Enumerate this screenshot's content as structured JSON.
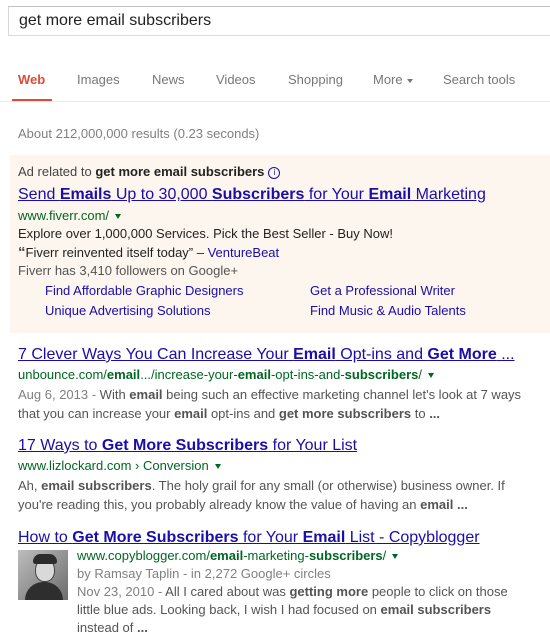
{
  "search": {
    "query": "get more email subscribers"
  },
  "tabs": {
    "web": "Web",
    "images": "Images",
    "news": "News",
    "videos": "Videos",
    "shopping": "Shopping",
    "more": "More",
    "tools": "Search tools"
  },
  "stats": "About 212,000,000 results (0.23 seconds)",
  "ad": {
    "header_prefix": "Ad related to ",
    "header_query": "get more email subscribers",
    "info_glyph": "i",
    "title": {
      "p1": "Send ",
      "b1": "Emails",
      "p2": " Up to 30,000 ",
      "b2": "Subscribers",
      "p3": " for Your ",
      "b3": "Email",
      "p4": " Marketing"
    },
    "url": "www.fiverr.com/",
    "line1": "Explore over 1,000,000 Services. Pick the Best Seller - Buy Now!",
    "quote_open": "“",
    "quote_text": "Fiverr reinvented itself today",
    "quote_close": "” – ",
    "quote_source": "VentureBeat",
    "followers": "Fiverr has 3,410 followers on Google+",
    "sitelinks": [
      "Find Affordable Graphic Designers",
      "Get a Professional Writer",
      "Unique Advertising Solutions",
      "Find Music & Audio Talents"
    ]
  },
  "results": [
    {
      "title": {
        "p1": "7 Clever Ways You Can Increase Your ",
        "b1": "Email",
        "p2": " Opt-ins and ",
        "b2": "Get More",
        "p3": " ..."
      },
      "url": {
        "p1": "unbounce.com/",
        "b1": "email",
        "p2": ".../increase-your-",
        "b2": "email",
        "p3": "-opt-ins-and-",
        "b3": "subscribers",
        "p4": "/"
      },
      "date": "Aug 6, 2013 - ",
      "snippet1": {
        "p1": "With ",
        "b1": "email",
        "p2": " being such an effective marketing channel let's look at 7 ways"
      },
      "snippet2": {
        "p1": "that you can increase your ",
        "b1": "email",
        "p2": " opt-ins and ",
        "b2": "get more subscribers",
        "p3": " to ",
        "b3": "..."
      }
    },
    {
      "title": {
        "p1": "17 Ways to ",
        "b1": "Get More Subscribers",
        "p2": " for Your List"
      },
      "url": "www.lizlockard.com › Conversion",
      "snippet1": {
        "p1": "Ah, ",
        "b1": "email subscribers",
        "p2": ". The holy grail for any small (or otherwise) business owner. If"
      },
      "snippet2": {
        "p1": "you're reading this, you probably already know the value of having an ",
        "b1": "email",
        "p2": "  ",
        "b2": "..."
      }
    },
    {
      "title": {
        "p1": "How to ",
        "b1": "Get More Subscribers",
        "p2": " for Your ",
        "b2": "Email",
        "p3": " List - Copyblogger"
      },
      "url": {
        "p1": "www.copyblogger.com/",
        "b1": "email",
        "p2": "-marketing-",
        "b2": "subscribers",
        "p3": "/"
      },
      "author": "by Ramsay Taplin - in 2,272 Google+ circles",
      "date": "Nov 23, 2010 - ",
      "snippet1": {
        "p1": "All I cared about was ",
        "b1": "getting more",
        "p2": " people to click on those"
      },
      "snippet2": {
        "p1": "little blue ads. Looking back, I wish I had focused on ",
        "b1": "email subscribers"
      },
      "snippet3": {
        "p1": "instead of ",
        "b1": "..."
      }
    }
  ]
}
